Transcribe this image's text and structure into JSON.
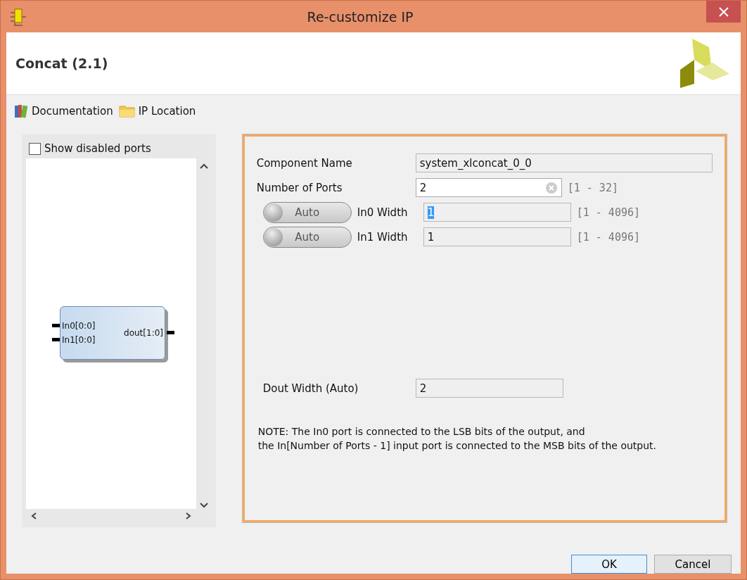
{
  "window": {
    "title": "Re-customize IP"
  },
  "header": {
    "title": "Concat (2.1)"
  },
  "toolbar": [
    {
      "label": "Documentation",
      "kind": "docs"
    },
    {
      "label": "IP Location",
      "kind": "folder"
    }
  ],
  "preview": {
    "show_disabled_ports": {
      "label": "Show disabled ports",
      "checked": false
    },
    "inputs": [
      "In0[0:0]",
      "In1[0:0]"
    ],
    "outputs": [
      "dout[1:0]"
    ]
  },
  "params": [
    {
      "kind": "text",
      "label": "Component Name",
      "value": "system_xlconcat_0_0",
      "disabled": true
    },
    {
      "kind": "number",
      "label": "Number of Ports",
      "value": "2",
      "range": "[1 - 32]",
      "disabled": false
    },
    {
      "kind": "width",
      "toggle": {
        "label": "Auto",
        "on": false
      },
      "label": "In0 Width",
      "value": "1",
      "range": "[1 - 4096]",
      "disabled": true,
      "highlighted": true
    },
    {
      "kind": "width",
      "toggle": {
        "label": "Auto",
        "on": false
      },
      "label": "In1 Width",
      "value": "1",
      "range": "[1 - 4096]",
      "disabled": true,
      "highlighted": false
    }
  ],
  "output": {
    "label": "Dout Width (Auto)",
    "value": "2",
    "disabled": true
  },
  "note": [
    "NOTE: The In0 port is connected to the LSB bits of the output, and",
    "the In[Number of Ports - 1] input port is connected to the MSB bits of the output."
  ],
  "buttons": [
    {
      "label": "OK",
      "default": true
    },
    {
      "label": "Cancel",
      "default": false
    }
  ]
}
